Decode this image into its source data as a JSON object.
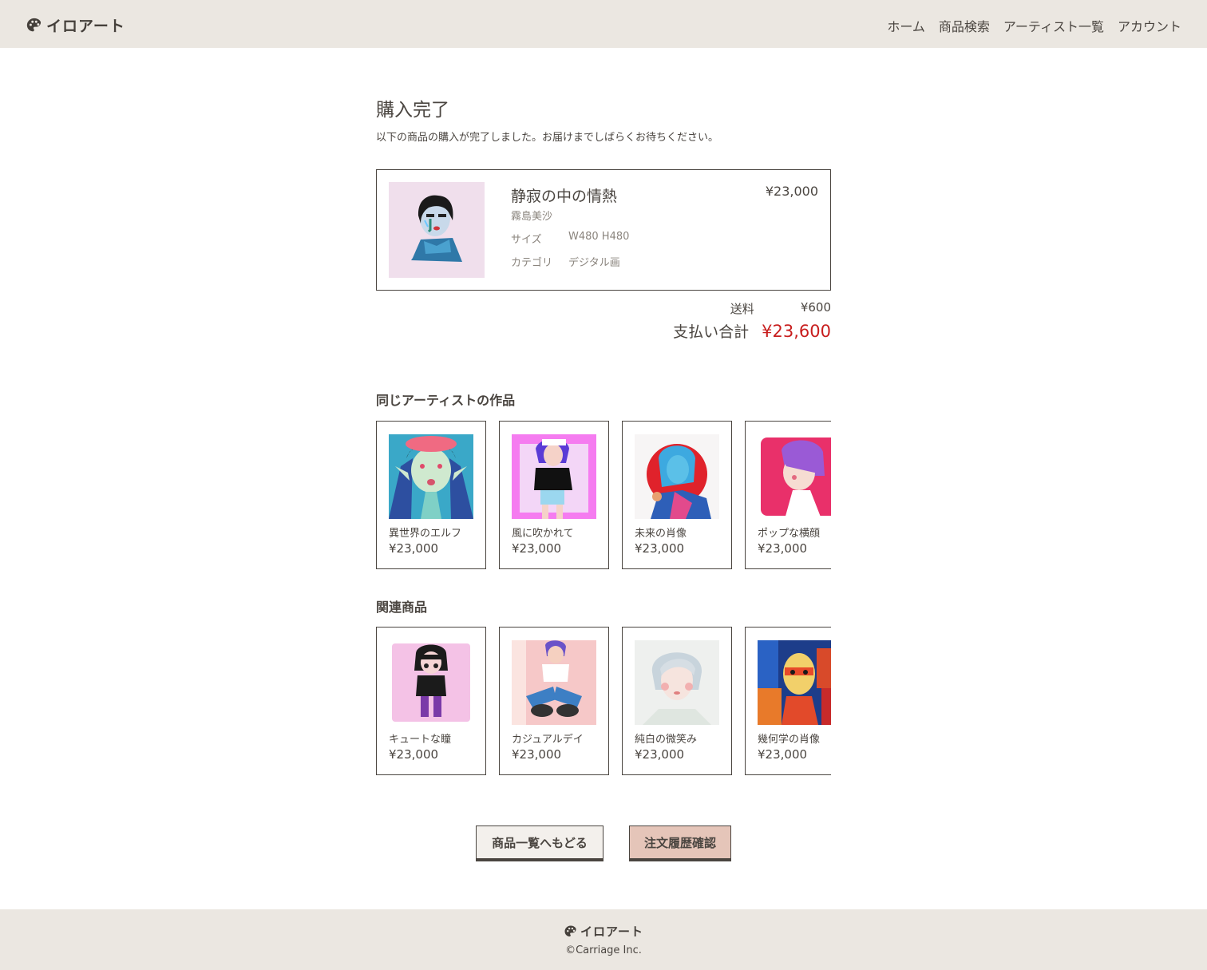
{
  "brand": {
    "name": "イロアート",
    "logo_icon": "palette-icon"
  },
  "nav": {
    "items": [
      "ホーム",
      "商品検索",
      "アーティスト一覧",
      "アカウント"
    ]
  },
  "page": {
    "title": "購入完了",
    "message": "以下の商品の購入が完了しました。お届けまでしばらくお待ちください。"
  },
  "order": {
    "name": "静寂の中の情熱",
    "artist": "霧島美沙",
    "size_label": "サイズ",
    "size_value": "W480 H480",
    "category_label": "カテゴリ",
    "category_value": "デジタル画",
    "price": "¥23,000"
  },
  "summary": {
    "shipping_label": "送料",
    "shipping_value": "¥600",
    "total_label": "支払い合計",
    "total_value": "¥23,600",
    "total_color": "#c81e1e"
  },
  "same_artist": {
    "title": "同じアーティストの作品",
    "items": [
      {
        "name": "異世界のエルフ",
        "price": "¥23,000"
      },
      {
        "name": "風に吹かれて",
        "price": "¥23,000"
      },
      {
        "name": "未来の肖像",
        "price": "¥23,000"
      },
      {
        "name": "ポップな横顔",
        "price": "¥23,000"
      }
    ]
  },
  "related": {
    "title": "関連商品",
    "items": [
      {
        "name": "キュートな瞳",
        "price": "¥23,000"
      },
      {
        "name": "カジュアルデイ",
        "price": "¥23,000"
      },
      {
        "name": "純白の微笑み",
        "price": "¥23,000"
      },
      {
        "name": "幾何学の肖像",
        "price": "¥23,000"
      }
    ]
  },
  "buttons": {
    "back": "商品一覧へもどる",
    "history": "注文履歴確認"
  },
  "footer": {
    "brand": "イロアート",
    "copyright": "©Carriage Inc."
  },
  "colors": {
    "header_bg": "#ebe7e1",
    "text": "#4a4540",
    "accent_button": "#e5c5b9"
  }
}
